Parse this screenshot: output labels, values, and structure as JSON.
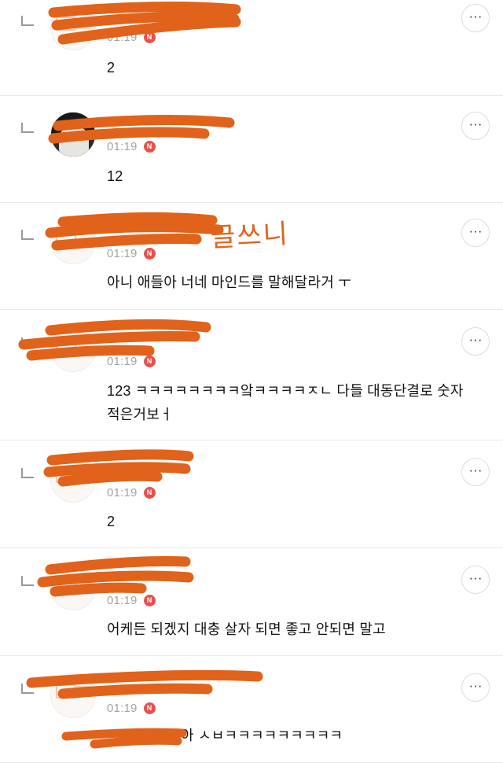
{
  "comments": [
    {
      "time": "01:19",
      "badge": "N",
      "text": "2",
      "more": "···",
      "avatar": "logo"
    },
    {
      "time": "01:19",
      "badge": "N",
      "text": "12",
      "more": "···",
      "avatar": "photo"
    },
    {
      "time": "01:19",
      "badge": "N",
      "text": "아니 애들아 너네 마인드를 말해달라거 ㅜ",
      "more": "···",
      "avatar": "logo"
    },
    {
      "time": "01:19",
      "badge": "N",
      "text": "123 ㅋㅋㅋㅋㅋㅋㅋㅋ앜ㅋㅋㅋㅋㅈㄴ 다들 대동단결로 숫자적은거보ㅓ",
      "more": "···",
      "avatar": "logo"
    },
    {
      "time": "01:19",
      "badge": "N",
      "text": "2",
      "more": "···",
      "avatar": "logo"
    },
    {
      "time": "01:19",
      "badge": "N",
      "text": "어케든 되겠지 대충 살자 되면 좋고 안되면 말고",
      "more": "···",
      "avatar": "logo"
    },
    {
      "time": "01:19",
      "badge": "N",
      "text": "아 ㅅㅂㅋㅋㅋㅋㅋㅋㅋㅋㅋ",
      "more": "···",
      "avatar": "logo"
    }
  ],
  "annotation": "글쓰니",
  "colors": {
    "redaction": "#e0621b",
    "badge": "#e9504d",
    "time": "#a3a3a3"
  }
}
